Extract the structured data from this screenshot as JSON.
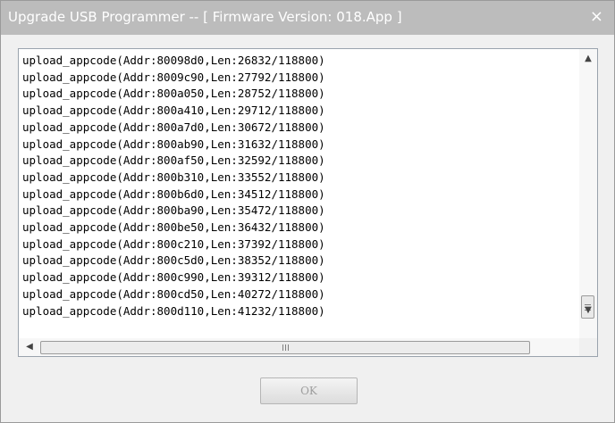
{
  "window": {
    "title": "Upgrade USB Programmer -- [ Firmware Version: 018.App ]",
    "close_glyph": "×"
  },
  "log": {
    "lines": [
      "upload_appcode(Addr:80098d0,Len:26832/118800)",
      "upload_appcode(Addr:8009c90,Len:27792/118800)",
      "upload_appcode(Addr:800a050,Len:28752/118800)",
      "upload_appcode(Addr:800a410,Len:29712/118800)",
      "upload_appcode(Addr:800a7d0,Len:30672/118800)",
      "upload_appcode(Addr:800ab90,Len:31632/118800)",
      "upload_appcode(Addr:800af50,Len:32592/118800)",
      "upload_appcode(Addr:800b310,Len:33552/118800)",
      "upload_appcode(Addr:800b6d0,Len:34512/118800)",
      "upload_appcode(Addr:800ba90,Len:35472/118800)",
      "upload_appcode(Addr:800be50,Len:36432/118800)",
      "upload_appcode(Addr:800c210,Len:37392/118800)",
      "upload_appcode(Addr:800c5d0,Len:38352/118800)",
      "upload_appcode(Addr:800c990,Len:39312/118800)",
      "upload_appcode(Addr:800cd50,Len:40272/118800)",
      "upload_appcode(Addr:800d110,Len:41232/118800)"
    ]
  },
  "scrollbars": {
    "up_icon": "▲",
    "down_icon": "▼",
    "left_icon": "◀",
    "right_icon": "▶"
  },
  "buttons": {
    "ok_label": "OK"
  }
}
